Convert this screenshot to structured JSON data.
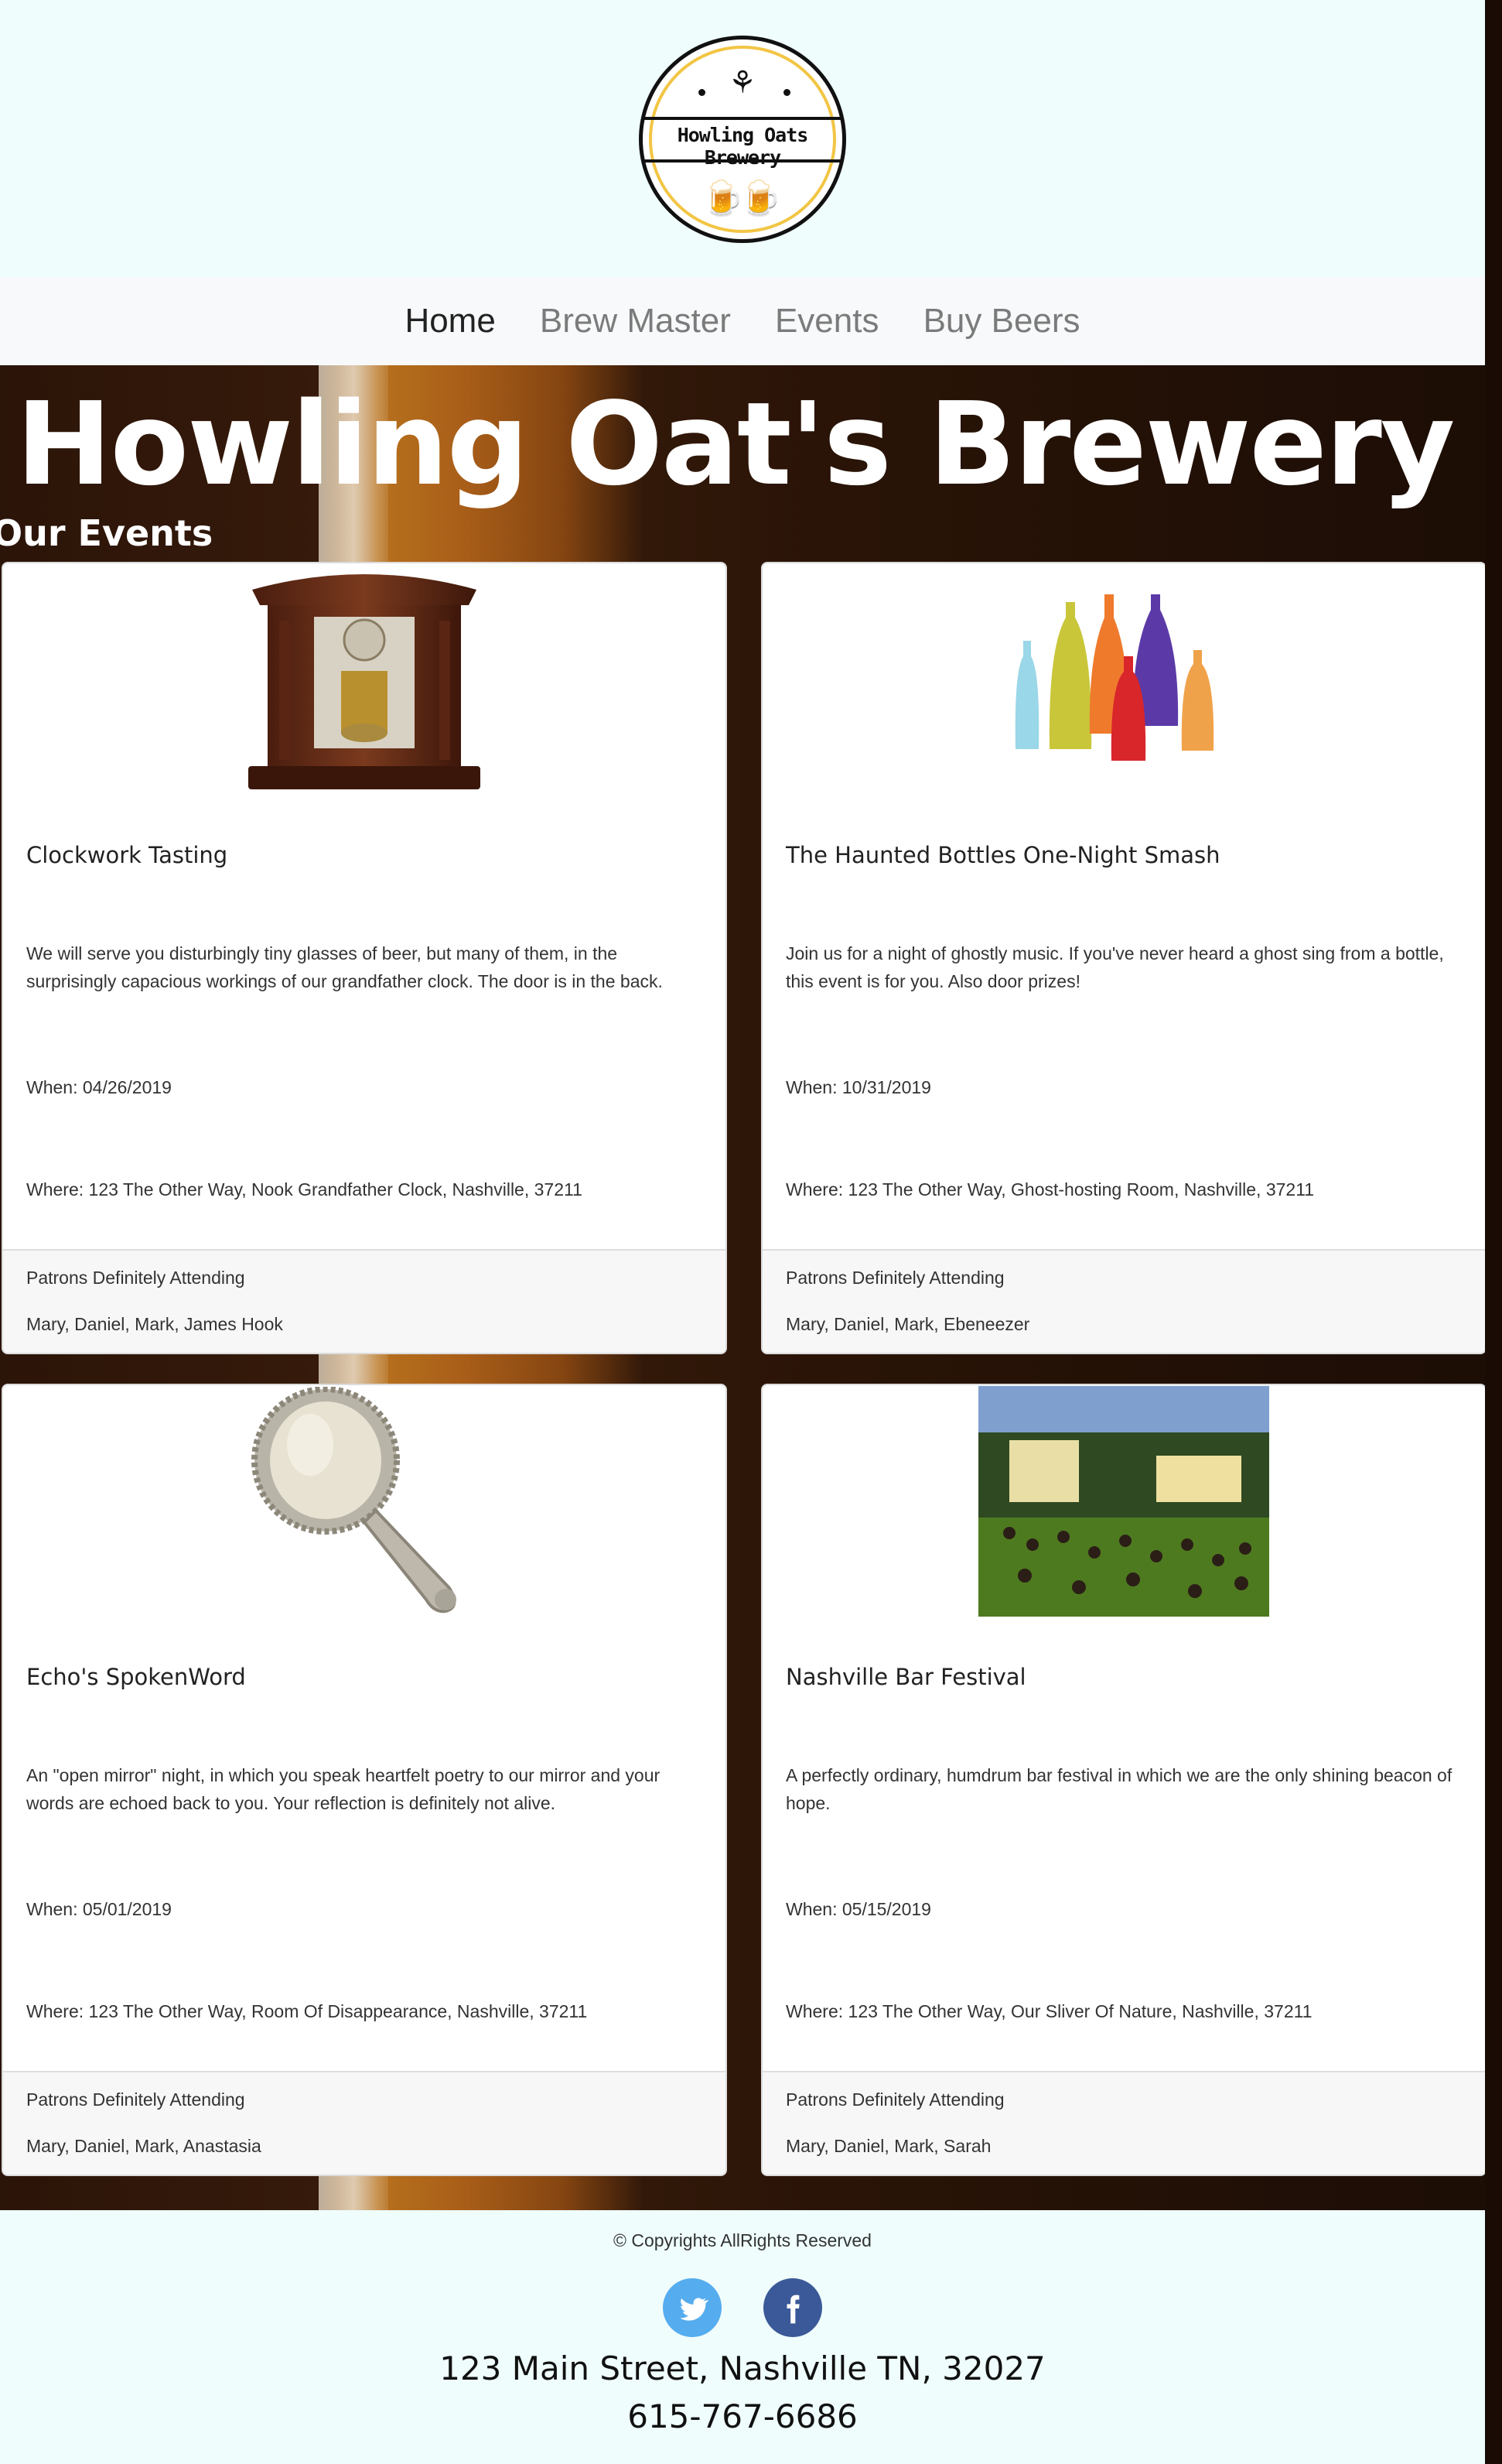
{
  "logo": {
    "text": "Howling Oats Brewery",
    "ring_color": "#f2c544"
  },
  "nav": {
    "items": [
      {
        "label": "Home",
        "active": true
      },
      {
        "label": "Brew Master",
        "active": false
      },
      {
        "label": "Events",
        "active": false
      },
      {
        "label": "Buy Beers",
        "active": false
      }
    ]
  },
  "hero": {
    "title": "Howling Oat's Brewery"
  },
  "section": {
    "title": "Our Events"
  },
  "events": [
    {
      "image_icon": "grandfather-clock-image",
      "title": "Clockwork Tasting",
      "description": "We will serve you disturbingly tiny glasses of beer, but many of them, in the surprisingly capacious workings of our grandfather clock. The door is in the back.",
      "when": "When: 04/26/2019",
      "where": "Where: 123 The Other Way, Nook Grandfather Clock, Nashville, 37211",
      "patrons_label": "Patrons Definitely Attending",
      "patrons": "Mary, Daniel, Mark, James Hook"
    },
    {
      "image_icon": "colored-bottles-image",
      "title": "The Haunted Bottles One-Night Smash",
      "description": "Join us for a night of ghostly music. If you've never heard a ghost sing from a bottle, this event is for you. Also door prizes!",
      "when": "When: 10/31/2019",
      "where": "Where: 123 The Other Way, Ghost-hosting Room, Nashville, 37211",
      "patrons_label": "Patrons Definitely Attending",
      "patrons": "Mary, Daniel, Mark, Ebeneezer"
    },
    {
      "image_icon": "hand-mirror-image",
      "title": "Echo's SpokenWord",
      "description": "An \"open mirror\" night, in which you speak heartfelt poetry to our mirror and your words are echoed back to you. Your reflection is definitely not alive.",
      "when": "When: 05/01/2019",
      "where": "Where: 123 The Other Way, Room Of Disappearance, Nashville, 37211",
      "patrons_label": "Patrons Definitely Attending",
      "patrons": "Mary, Daniel, Mark, Anastasia"
    },
    {
      "image_icon": "festival-crowd-image",
      "title": "Nashville Bar Festival",
      "description": "A perfectly ordinary, humdrum bar festival in which we are the only shining beacon of hope.",
      "when": "When: 05/15/2019",
      "where": "Where: 123 The Other Way, Our Sliver Of Nature, Nashville, 37211",
      "patrons_label": "Patrons Definitely Attending",
      "patrons": "Mary, Daniel, Mark, Sarah"
    }
  ],
  "footer": {
    "copyright": "© Copyrights AllRights Reserved",
    "social": [
      {
        "icon": "twitter-icon",
        "color": "#55acee"
      },
      {
        "icon": "facebook-icon",
        "color": "#3b5998"
      }
    ],
    "address": "123 Main Street, Nashville TN, 32027",
    "phone": "615-767-6686"
  },
  "colors": {
    "header_bg": "#effdfd",
    "nav_bg": "#f8f9fa",
    "hero_bg": "#2b1408"
  }
}
